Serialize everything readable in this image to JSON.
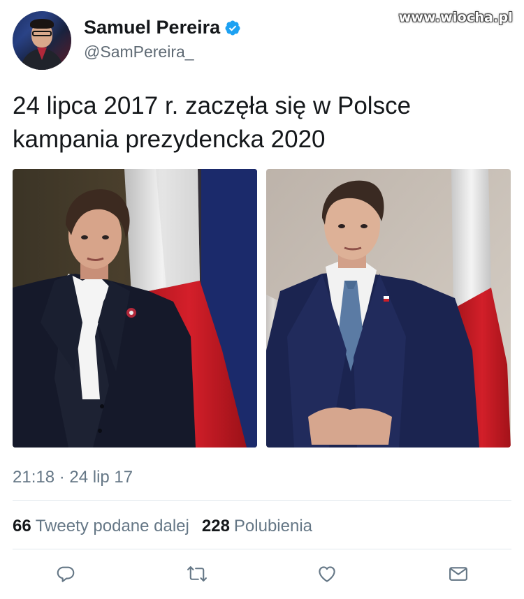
{
  "watermark": "www.wiocha.pl",
  "author": {
    "display_name": "Samuel Pereira",
    "handle": "@SamPereira_",
    "verified": true
  },
  "tweet": {
    "text_line1": "24 lipca 2017 r. zaczęła się w Polsce",
    "text_line2": "kampania prezydencka 2020",
    "timestamp": "21:18 · 24 lip 17"
  },
  "media": [
    {
      "description_icon": "portrait-photo-woman-with-polish-flag"
    },
    {
      "description_icon": "portrait-photo-man-with-polish-flag"
    }
  ],
  "stats": {
    "retweets_count": "66",
    "retweets_label": "Tweety podane dalej",
    "likes_count": "228",
    "likes_label": "Polubienia"
  },
  "actions": {
    "reply_icon": "reply-icon",
    "retweet_icon": "retweet-icon",
    "like_icon": "heart-icon",
    "message_icon": "envelope-icon"
  },
  "colors": {
    "text": "#14171a",
    "secondary": "#657786",
    "verified_blue": "#1da1f2",
    "divider": "#e1e8ed"
  }
}
